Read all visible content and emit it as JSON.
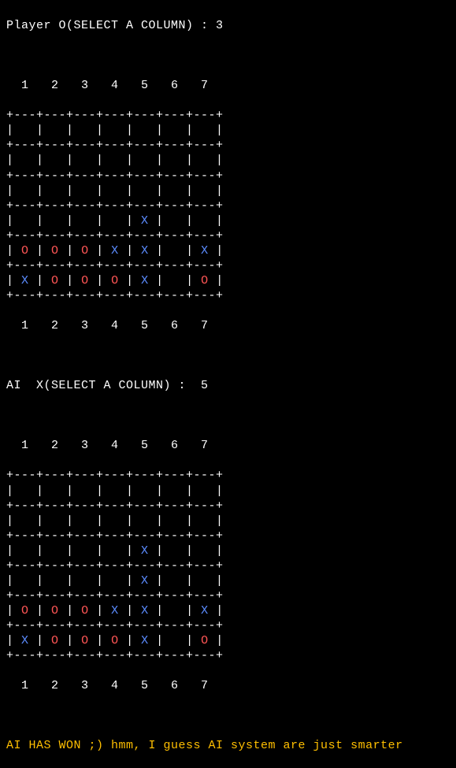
{
  "turn1": {
    "prompt": "Player O(SELECT A COLUMN) : 3"
  },
  "turn2": {
    "prompt": "AI  X(SELECT A COLUMN) :  5"
  },
  "board": {
    "colHeader": "  1   2   3   4   5   6   7",
    "divider": "+---+---+---+---+---+---+---+",
    "pipe": "|",
    "cellPad": " ",
    "width": 7,
    "height": 6
  },
  "boards": {
    "b1": [
      [
        " ",
        " ",
        " ",
        " ",
        " ",
        " ",
        " "
      ],
      [
        " ",
        " ",
        " ",
        " ",
        " ",
        " ",
        " "
      ],
      [
        " ",
        " ",
        " ",
        " ",
        " ",
        " ",
        " "
      ],
      [
        " ",
        " ",
        " ",
        " ",
        "X",
        " ",
        " "
      ],
      [
        "O",
        "O",
        "O",
        "X",
        "X",
        " ",
        "X"
      ],
      [
        "X",
        "O",
        "O",
        "O",
        "X",
        " ",
        "O"
      ]
    ],
    "b2": [
      [
        " ",
        " ",
        " ",
        " ",
        " ",
        " ",
        " "
      ],
      [
        " ",
        " ",
        " ",
        " ",
        " ",
        " ",
        " "
      ],
      [
        " ",
        " ",
        " ",
        " ",
        "X",
        " ",
        " "
      ],
      [
        " ",
        " ",
        " ",
        " ",
        "X",
        " ",
        " "
      ],
      [
        "O",
        "O",
        "O",
        "X",
        "X",
        " ",
        "X"
      ],
      [
        "X",
        "O",
        "O",
        "O",
        "X",
        " ",
        "O"
      ]
    ]
  },
  "winMessage": "AI HAS WON ;) hmm, I guess AI system are just smarter"
}
